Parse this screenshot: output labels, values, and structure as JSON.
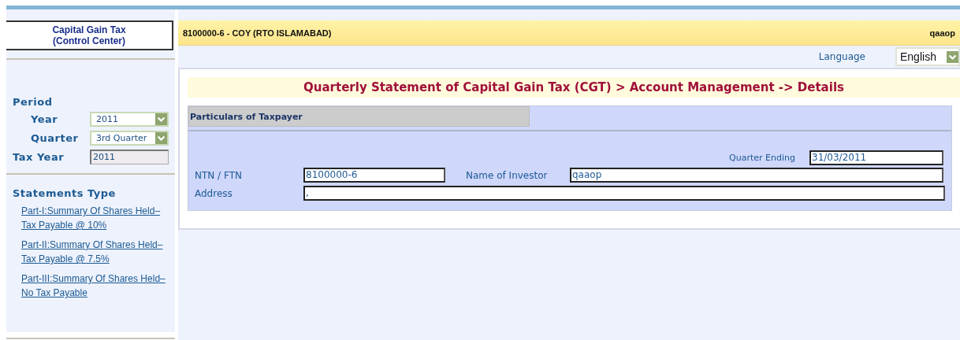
{
  "sidebar": {
    "title": "Capital Gain Tax",
    "subtitle": "(Control Center)",
    "period_heading": "Period",
    "year": {
      "label": "Year",
      "value": "2011"
    },
    "quarter": {
      "label": "Quarter",
      "value": "3rd Quarter"
    },
    "tax_year": {
      "label": "Tax Year",
      "value": "2011"
    },
    "statements_heading": "Statements Type",
    "statement_links": [
      "Part-I:Summary Of Shares Held– Tax Payable @ 10%",
      "Part-II:Summary Of Shares Held– Tax Payable @ 7.5%",
      "Part-III:Summary Of Shares Held– No Tax Payable"
    ]
  },
  "header": {
    "account": "8100000-6 - COY (RTO ISLAMABAD)",
    "user": "qaaop"
  },
  "language": {
    "label": "Language",
    "value": "English"
  },
  "page_title": "Quarterly Statement of Capital Gain Tax (CGT) > Account Management -> Details",
  "section": {
    "title": "Particulars of Taxpayer",
    "quarter_ending": {
      "label": "Quarter Ending",
      "value": "31/03/2011"
    },
    "ntn": {
      "label": "NTN / FTN",
      "value": "8100000-6"
    },
    "investor": {
      "label": "Name of Investor",
      "value": "qaaop"
    },
    "address": {
      "label": "Address",
      "value": ","
    }
  }
}
